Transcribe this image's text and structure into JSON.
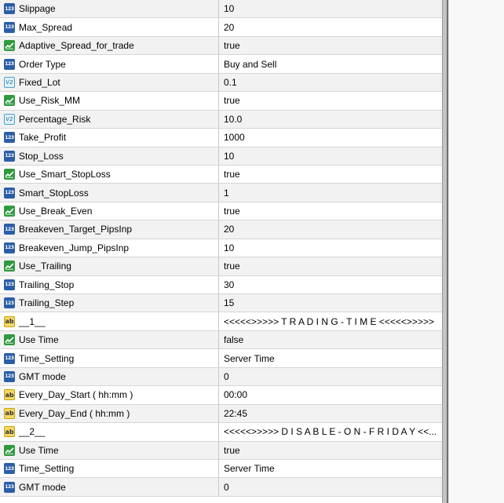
{
  "parameters": [
    {
      "type": "int",
      "name": "Slippage",
      "value": "10"
    },
    {
      "type": "int",
      "name": "Max_Spread",
      "value": "20"
    },
    {
      "type": "bool",
      "name": "Adaptive_Spread_for_trade",
      "value": "true"
    },
    {
      "type": "int",
      "name": "Order Type",
      "value": "Buy and Sell"
    },
    {
      "type": "double",
      "name": "Fixed_Lot",
      "value": "0.1"
    },
    {
      "type": "bool",
      "name": "Use_Risk_MM",
      "value": "true"
    },
    {
      "type": "double",
      "name": "Percentage_Risk",
      "value": "10.0"
    },
    {
      "type": "int",
      "name": "Take_Profit",
      "value": "1000"
    },
    {
      "type": "int",
      "name": "Stop_Loss",
      "value": "10"
    },
    {
      "type": "bool",
      "name": "Use_Smart_StopLoss",
      "value": "true"
    },
    {
      "type": "int",
      "name": "Smart_StopLoss",
      "value": "1"
    },
    {
      "type": "bool",
      "name": "Use_Break_Even",
      "value": "true"
    },
    {
      "type": "int",
      "name": "Breakeven_Target_PipsInp",
      "value": "20"
    },
    {
      "type": "int",
      "name": "Breakeven_Jump_PipsInp",
      "value": "10"
    },
    {
      "type": "bool",
      "name": "Use_Trailing",
      "value": "true"
    },
    {
      "type": "int",
      "name": "Trailing_Stop",
      "value": "30"
    },
    {
      "type": "int",
      "name": "Trailing_Step",
      "value": "15"
    },
    {
      "type": "string",
      "name": "__1__",
      "value": "<<<<<>>>>> T R A D I N G - T I M E <<<<<>>>>>"
    },
    {
      "type": "bool",
      "name": "Use Time",
      "value": "false"
    },
    {
      "type": "int",
      "name": "Time_Setting",
      "value": "Server Time"
    },
    {
      "type": "int",
      "name": "GMT mode",
      "value": "0"
    },
    {
      "type": "string",
      "name": "Every_Day_Start ( hh:mm )",
      "value": "00:00"
    },
    {
      "type": "string",
      "name": "Every_Day_End ( hh:mm )",
      "value": "22:45"
    },
    {
      "type": "string",
      "name": "__2__",
      "value": "<<<<<>>>>> D I S A B L E - O N - F R I D A Y <<..."
    },
    {
      "type": "bool",
      "name": "Use Time",
      "value": "true"
    },
    {
      "type": "int",
      "name": "Time_Setting",
      "value": "Server Time"
    },
    {
      "type": "int",
      "name": "GMT mode",
      "value": "0"
    }
  ],
  "icons": {
    "int": {
      "name": "integer-type-icon",
      "glyph": "123",
      "color": "#2b5ea8"
    },
    "bool": {
      "name": "boolean-type-icon",
      "color": "#2f9a3e"
    },
    "double": {
      "name": "double-type-icon",
      "glyph": "V2",
      "color": "#4aa3c9"
    },
    "string": {
      "name": "string-type-icon",
      "glyph": "ab",
      "color": "#f3d86a"
    }
  }
}
